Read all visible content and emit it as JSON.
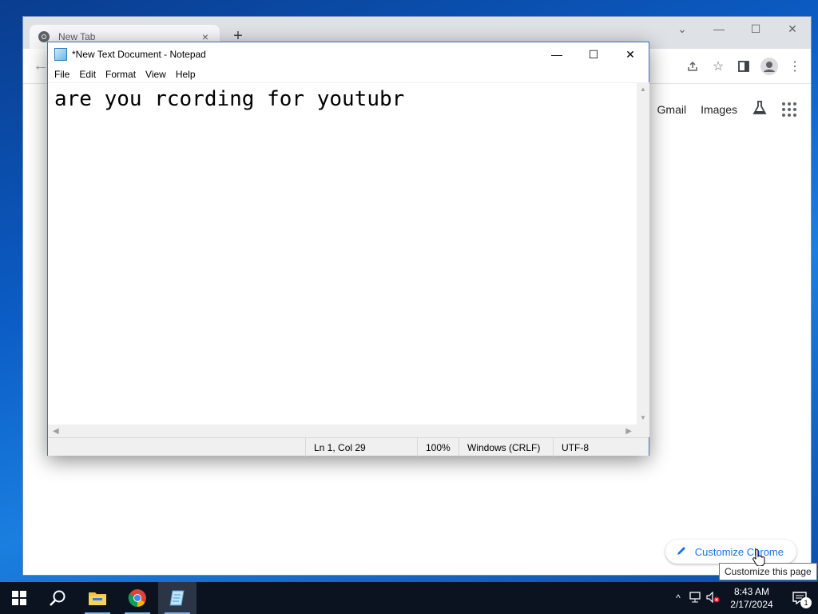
{
  "chrome": {
    "tab_title": "New Tab",
    "tab_close": "×",
    "new_tab": "+",
    "window_buttons": {
      "dropdown": "⌄",
      "minimize": "—",
      "maximize": "☐",
      "close": "✕"
    },
    "links": {
      "gmail": "Gmail",
      "images": "Images"
    },
    "customize_label": "Customize Chrome",
    "tooltip": "Customize this page"
  },
  "notepad": {
    "title": "*New Text Document - Notepad",
    "menu": [
      "File",
      "Edit",
      "Format",
      "View",
      "Help"
    ],
    "content": "are you rcording for youtubr",
    "status": {
      "position": "Ln 1, Col 29",
      "zoom": "100%",
      "line_ending": "Windows (CRLF)",
      "encoding": "UTF-8"
    },
    "window_buttons": {
      "minimize": "—",
      "maximize": "☐",
      "close": "✕"
    }
  },
  "taskbar": {
    "apps": [
      "start-icon",
      "search-icon",
      "file-explorer-icon",
      "chrome-icon",
      "notepad-icon"
    ],
    "clock_time": "8:43 AM",
    "clock_date": "2/17/2024",
    "notification_count": "1"
  },
  "colors": {
    "accent_blue": "#1a73e8",
    "taskbar_bg": "#0b1220",
    "desktop_blue": "#0b5cc4"
  }
}
